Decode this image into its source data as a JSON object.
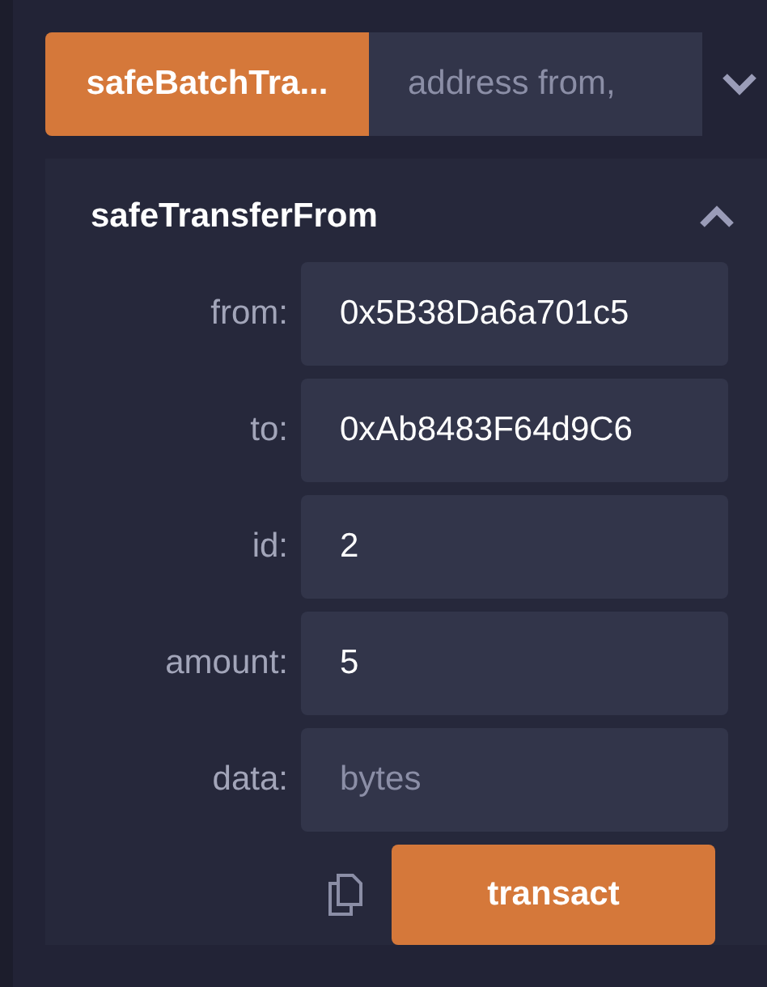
{
  "collapsed_function": {
    "label": "safeBatchTra...",
    "placeholder": "address from,",
    "expanded": false
  },
  "expanded_function": {
    "title": "safeTransferFrom",
    "expanded": true,
    "params": [
      {
        "label": "from:",
        "value": "0x5B38Da6a701c5"
      },
      {
        "label": "to:",
        "value": "0xAb8483F64d9C6"
      },
      {
        "label": "id:",
        "value": "2"
      },
      {
        "label": "amount:",
        "value": "5"
      },
      {
        "label": "data:",
        "placeholder": "bytes"
      }
    ],
    "button": "transact"
  }
}
